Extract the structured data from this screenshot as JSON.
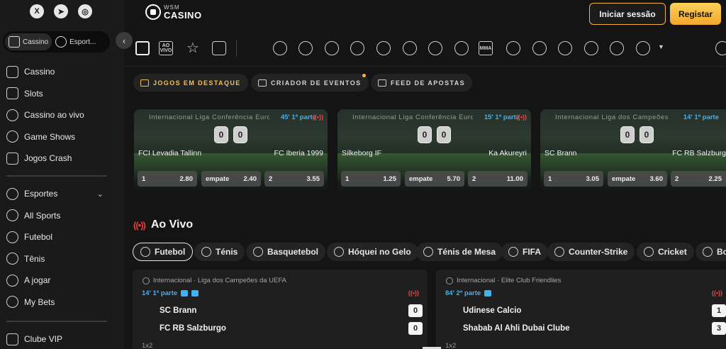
{
  "sidebar": {
    "social": [
      {
        "icon": "x-icon",
        "glyph": "X"
      },
      {
        "icon": "telegram-icon",
        "glyph": "➤"
      },
      {
        "icon": "instagram-icon",
        "glyph": "◎"
      }
    ],
    "switch": {
      "casino": "Cassino",
      "sports": "Esport..."
    },
    "casino_items": [
      {
        "label": "Cassino",
        "icon": "casino-icon"
      },
      {
        "label": "Slots",
        "icon": "slots-icon"
      },
      {
        "label": "Cassino ao vivo",
        "icon": "live-casino-icon"
      },
      {
        "label": "Game Shows",
        "icon": "game-shows-icon"
      },
      {
        "label": "Jogos Crash",
        "icon": "rocket-icon"
      }
    ],
    "sports_items": [
      {
        "label": "Esportes",
        "icon": "sports-icon"
      },
      {
        "label": "All Sports",
        "icon": "all-sports-icon"
      },
      {
        "label": "Futebol",
        "icon": "football-icon"
      },
      {
        "label": "Tênis",
        "icon": "tennis-icon"
      },
      {
        "label": "A jogar",
        "icon": "live-icon"
      },
      {
        "label": "My Bets",
        "icon": "bets-icon"
      }
    ],
    "vip_items": [
      {
        "label": "Clube VIP",
        "icon": "vip-icon"
      }
    ]
  },
  "header": {
    "logo_small": "WSM",
    "logo_big": "CASINO",
    "login": "Iniciar sessão",
    "register": "Registar"
  },
  "sportsbar": {
    "ao_vivo_tag": "AO VIVO",
    "mma_tag": "MMA"
  },
  "featured_tabs": [
    {
      "label": "JOGOS EM DESTAQUE",
      "icon": "featured-icon"
    },
    {
      "label": "CRIADOR DE EVENTOS",
      "icon": "event-builder-icon"
    },
    {
      "label": "FEED DE APOSTAS",
      "icon": "feed-icon"
    }
  ],
  "featured_matches": [
    {
      "league": "Internacional Liga Conferência Euro",
      "status": "45' 1ª parte",
      "live": "((•))",
      "score_home": "0",
      "score_away": "0",
      "home": "FCI Levadia Tallinn",
      "away": "FC Iberia 1999",
      "odds": [
        {
          "label": "1",
          "value": "2.80"
        },
        {
          "label": "empate",
          "value": "2.40"
        },
        {
          "label": "2",
          "value": "3.55"
        }
      ]
    },
    {
      "league": "Internacional Liga Conferência Euro",
      "status": "15' 1ª parte",
      "live": "((•))",
      "score_home": "0",
      "score_away": "0",
      "home": "Silkeborg IF",
      "away": "Ka Akureyri",
      "odds": [
        {
          "label": "1",
          "value": "1.25"
        },
        {
          "label": "empate",
          "value": "5.70"
        },
        {
          "label": "2",
          "value": "11.00"
        }
      ]
    },
    {
      "league": "Internacional Liga dos Campeões",
      "status": "14' 1ª parte",
      "live": "((•))",
      "score_home": "0",
      "score_away": "0",
      "home": "SC Brann",
      "away": "FC RB Salzburg",
      "odds": [
        {
          "label": "1",
          "value": "3.05"
        },
        {
          "label": "empate",
          "value": "3.60"
        },
        {
          "label": "2",
          "value": "2.25"
        }
      ]
    }
  ],
  "live": {
    "title": "Ao Vivo",
    "icon_glyph": "((•))",
    "sports": [
      {
        "label": "Futebol",
        "icon": "football-icon"
      },
      {
        "label": "Ténis",
        "icon": "tennis-icon"
      },
      {
        "label": "Basquetebol",
        "icon": "basketball-icon"
      },
      {
        "label": "Hóquei no Gelo",
        "icon": "ice-hockey-icon"
      },
      {
        "label": "Ténis de Mesa",
        "icon": "table-tennis-icon"
      },
      {
        "label": "FIFA",
        "icon": "fifa-icon"
      },
      {
        "label": "Counter-Strike",
        "icon": "counter-strike-icon"
      },
      {
        "label": "Cricket",
        "icon": "cricket-icon"
      },
      {
        "label": "Bo",
        "icon": "more-sport-icon"
      }
    ],
    "matches": [
      {
        "league": "Internacional · Liga dos Campeões da UEFA",
        "status": "14' 1ª parte",
        "live": "((•))",
        "home": "SC Brann",
        "home_score": "0",
        "away": "FC RB Salzburgo",
        "away_score": "0",
        "market": "1x2"
      },
      {
        "league": "Internacional · Elite Club Friendlies",
        "status": "84' 2ª parte",
        "live": "((•))",
        "home": "Udinese Calcio",
        "home_score": "1",
        "away": "Shabab Al Ahli Dubai Clube",
        "away_score": "3",
        "market": "1x2"
      }
    ]
  }
}
